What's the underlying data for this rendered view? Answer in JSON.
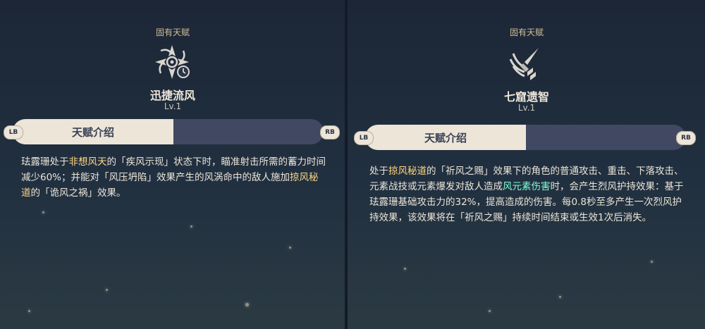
{
  "left": {
    "category": "固有天赋",
    "icon": "wind-compass-clock-icon",
    "talent_name": "迅捷流风",
    "level": "Lv.1",
    "tab_label": "天赋介绍",
    "lb": "LB",
    "rb": "RB",
    "desc": {
      "p1": "珐露珊处于",
      "h1": "非想风天",
      "p2": "的「疾风示现」状态下时，瞄准射击所需的蓄力时间减少60%；并能对「风压坍陷」效果产生的风涡命中的敌人施加",
      "h2": "掠风秘道",
      "p3": "的「诡风之祸」效果。"
    }
  },
  "right": {
    "category": "固有天赋",
    "icon": "feather-arrow-emblem-icon",
    "talent_name": "七窟遗智",
    "level": "Lv.1",
    "tab_label": "天赋介绍",
    "lb": "LB",
    "rb": "RB",
    "desc": {
      "p1": "处于",
      "h1": "掠风秘道",
      "p2": "的「祈风之赐」效果下的角色的普通攻击、重击、下落攻击、元素战技或元素爆发对敌人造成",
      "h2": "风元素伤害",
      "p3": "时，会产生烈风护持效果：基于珐露珊基础攻击力的32%，提高造成的伤害。每0.8秒至多产生一次烈风护持效果，该效果将在「祈风之赐」持续时间结束或生效1次后消失。"
    }
  },
  "colors": {
    "highlight_gold": "#ffd780",
    "highlight_anemo": "#80ffd7",
    "tab_active": "#ece5d8",
    "tab_inactive": "#414962"
  }
}
